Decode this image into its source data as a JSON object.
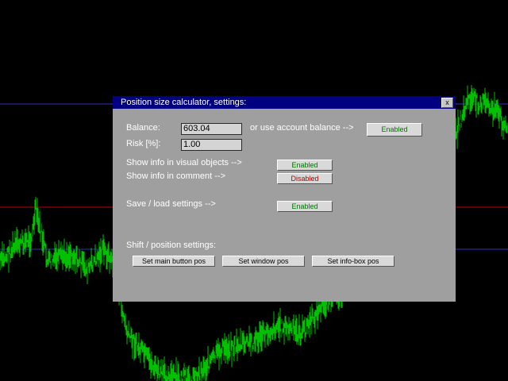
{
  "colors": {
    "background": "#000000",
    "candles": "#00c000",
    "line_blue": "#3030c0",
    "line_red": "#c00000",
    "panel": "#9f9f9f",
    "titlebar": "#000080",
    "enabled_text": "#007000",
    "disabled_text": "#b00000"
  },
  "dialog": {
    "title": "Position size calculator, settings:",
    "close_label": "x",
    "balance_label": "Balance:",
    "balance_value": "603.04",
    "account_balance_label": "or use account balance -->",
    "account_balance_toggle": "Enabled",
    "risk_label": "Risk [%]:",
    "risk_value": "1.00",
    "visual_objects_label": "Show info in visual objects -->",
    "visual_objects_toggle": "Enabled",
    "comment_label": "Show info in comment -->",
    "comment_toggle": "Disabled",
    "save_load_label": "Save / load settings -->",
    "save_load_toggle": "Enabled",
    "shift_label": "Shift / position settings:",
    "set_main_button_pos": "Set main button pos",
    "set_window_pos": "Set window pos",
    "set_infobox_pos": "Set info-box pos"
  }
}
